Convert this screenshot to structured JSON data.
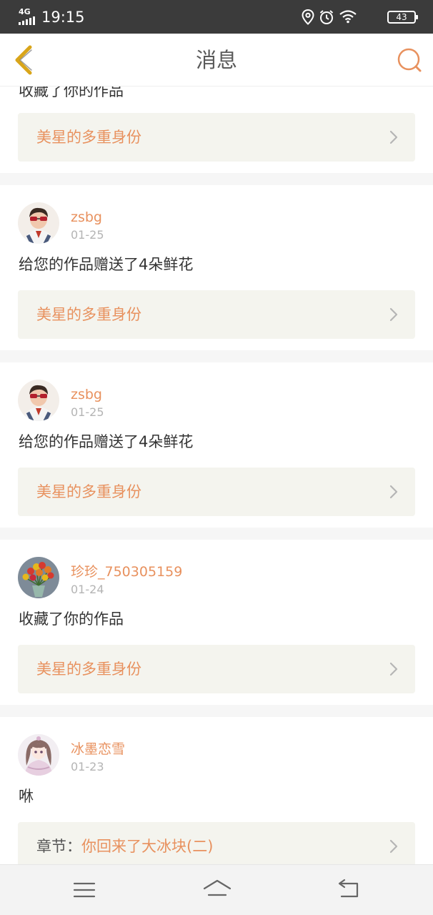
{
  "status_bar": {
    "network": "4G",
    "time": "19:15",
    "battery": "43"
  },
  "header": {
    "title": "消息"
  },
  "messages": [
    {
      "action": "收藏了你的作品",
      "ref_text": "美星的多重身份"
    },
    {
      "user": "zsbg",
      "date": "01-25",
      "action": "给您的作品赠送了4朵鲜花",
      "ref_text": "美星的多重身份"
    },
    {
      "user": "zsbg",
      "date": "01-25",
      "action": "给您的作品赠送了4朵鲜花",
      "ref_text": "美星的多重身份"
    },
    {
      "user": "珍珍_750305159",
      "date": "01-24",
      "action": "收藏了你的作品",
      "ref_text": "美星的多重身份"
    },
    {
      "user": "冰墨恋雪",
      "date": "01-23",
      "action": "咻",
      "ref_prefix": "章节：",
      "ref_text": "你回来了大冰块(二)"
    }
  ],
  "colors": {
    "accent": "#e8915e",
    "back_arrow": "#d9a51a",
    "ref_background": "#f4f4ee",
    "status_bar": "#3b3b3b"
  },
  "icons": {
    "back": "chevron-left-icon",
    "search": "search-icon",
    "ref_arrow": "chevron-right-icon",
    "nav_menu": "menu-icon",
    "nav_home": "home-icon",
    "nav_back": "return-icon"
  }
}
